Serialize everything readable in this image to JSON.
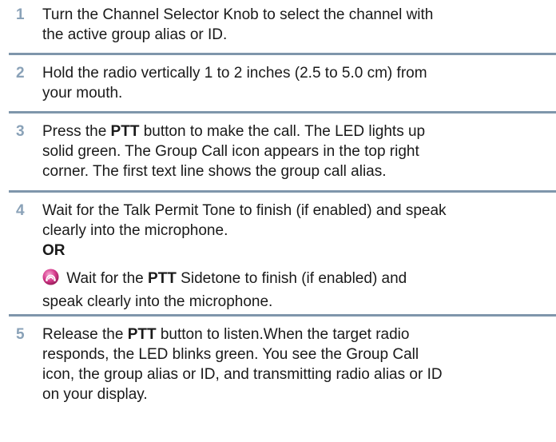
{
  "steps": [
    {
      "number": "1",
      "lines": [
        "Turn the Channel Selector Knob to select the channel with",
        "the active group alias or ID."
      ]
    },
    {
      "number": "2",
      "lines": [
        "Hold the radio vertically 1 to 2 inches (2.5 to 5.0 cm) from",
        "your mouth."
      ]
    },
    {
      "number": "3",
      "line1_before": "Press the ",
      "line1_bold": "PTT",
      "line1_after": " button to make the call. The LED lights up",
      "lines": [
        "solid green.  The Group Call icon appears in the top right",
        "corner. The first text line shows the group call alias."
      ]
    },
    {
      "number": "4",
      "lines": [
        "Wait for the Talk Permit Tone to finish (if enabled) and speak",
        "clearly into the microphone."
      ],
      "or_label": "OR",
      "alt_before": "Wait for the ",
      "alt_bold": "PTT",
      "alt_after": " Sidetone to finish (if enabled) and",
      "alt_line2": "speak clearly into the microphone.",
      "alt_icon": "sidetone-icon"
    },
    {
      "number": "5",
      "line1_before": "Release the ",
      "line1_bold": "PTT",
      "line1_after": " button to listen.When the target radio",
      "lines": [
        "responds, the LED blinks green. You see the Group Call",
        "icon, the group alias or ID, and transmitting radio alias or ID",
        "on your display."
      ]
    }
  ],
  "colors": {
    "step_number": "#8aa2b8",
    "rule": "#7f96ab",
    "icon_pink": "#d63a8c"
  }
}
